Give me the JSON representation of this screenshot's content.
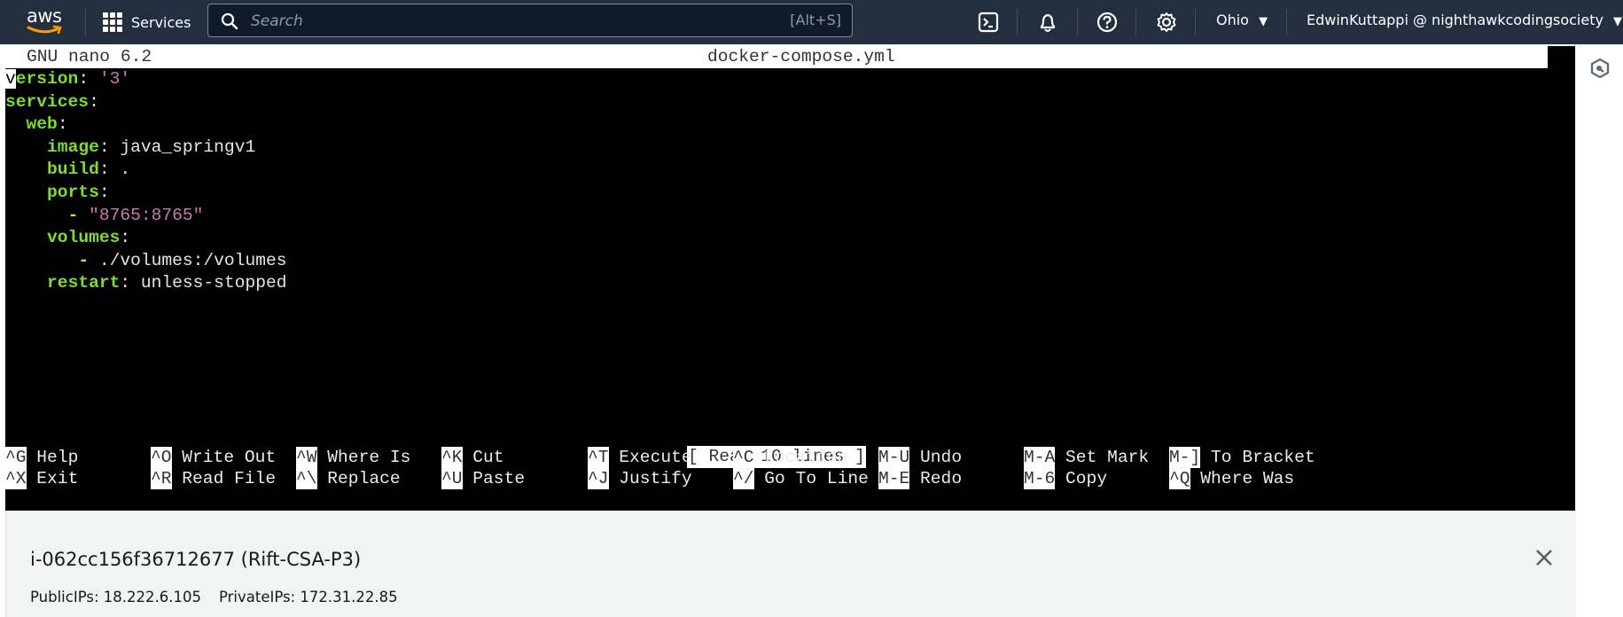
{
  "topbar": {
    "logo": "aws",
    "services_label": "Services",
    "search": {
      "placeholder": "Search",
      "value": "",
      "shortcut": "[Alt+S]"
    },
    "icons": [
      "cloudshell-icon",
      "bell-icon",
      "help-icon",
      "gear-icon"
    ],
    "region": "Ohio",
    "region_caret": "▼",
    "user": "EdwinKuttappi @ nighthawkcodingsociety",
    "user_caret": "▼"
  },
  "nano": {
    "version": "GNU nano 6.2",
    "filename": "docker-compose.yml",
    "lines": [
      [
        {
          "t": "v",
          "c": "cursor"
        },
        {
          "t": "ersion",
          "c": "k"
        },
        {
          "t": ": ",
          "c": "v"
        },
        {
          "t": "'3'",
          "c": "s"
        }
      ],
      [
        {
          "t": "services",
          "c": "k"
        },
        {
          "t": ":",
          "c": "v"
        }
      ],
      [
        {
          "t": "  "
        },
        {
          "t": "web",
          "c": "k"
        },
        {
          "t": ":",
          "c": "v"
        }
      ],
      [
        {
          "t": "    "
        },
        {
          "t": "image",
          "c": "k"
        },
        {
          "t": ": java_springv1",
          "c": "v"
        }
      ],
      [
        {
          "t": "    "
        },
        {
          "t": "build",
          "c": "k"
        },
        {
          "t": ": .",
          "c": "v"
        }
      ],
      [
        {
          "t": "    "
        },
        {
          "t": "ports",
          "c": "k"
        },
        {
          "t": ":",
          "c": "v"
        }
      ],
      [
        {
          "t": "      "
        },
        {
          "t": "-",
          "c": "d"
        },
        {
          "t": " "
        },
        {
          "t": "\"8765:8765\"",
          "c": "s"
        }
      ],
      [
        {
          "t": "    "
        },
        {
          "t": "volumes",
          "c": "k"
        },
        {
          "t": ":",
          "c": "v"
        }
      ],
      [
        {
          "t": "       "
        },
        {
          "t": "-",
          "c": "d"
        },
        {
          "t": " ./volumes:/volumes",
          "c": "v"
        }
      ],
      [
        {
          "t": "    "
        },
        {
          "t": "restart",
          "c": "k"
        },
        {
          "t": ": unless-stopped",
          "c": "v"
        }
      ]
    ],
    "status": "[ Read 10 lines ]",
    "shortcuts_row1": [
      {
        "key": "^G",
        "label": "Help"
      },
      {
        "key": "^O",
        "label": "Write Out"
      },
      {
        "key": "^W",
        "label": "Where Is"
      },
      {
        "key": "^K",
        "label": "Cut"
      },
      {
        "key": "^T",
        "label": "Execute"
      },
      {
        "key": "^C",
        "label": "Location"
      },
      {
        "key": "M-U",
        "label": "Undo"
      },
      {
        "key": "M-A",
        "label": "Set Mark"
      },
      {
        "key": "M-]",
        "label": "To Bracket"
      }
    ],
    "shortcuts_row2": [
      {
        "key": "^X",
        "label": "Exit"
      },
      {
        "key": "^R",
        "label": "Read File"
      },
      {
        "key": "^\\",
        "label": "Replace"
      },
      {
        "key": "^U",
        "label": "Paste"
      },
      {
        "key": "^J",
        "label": "Justify"
      },
      {
        "key": "^/",
        "label": "Go To Line"
      },
      {
        "key": "M-E",
        "label": "Redo"
      },
      {
        "key": "M-6",
        "label": "Copy"
      },
      {
        "key": "^Q",
        "label": "Where Was"
      }
    ]
  },
  "instance_panel": {
    "title": "i-062cc156f36712677 (Rift-CSA-P3)",
    "public_ips": "PublicIPs: 18.222.6.105",
    "private_ips": "PrivateIPs: 172.31.22.85"
  },
  "colors": {
    "topbar": "#232f3e",
    "yaml_key": "#7ddc2f",
    "yaml_string": "#c57bb8",
    "yaml_dash": "#f2d31b",
    "panel_bg": "#f2f3f3"
  }
}
